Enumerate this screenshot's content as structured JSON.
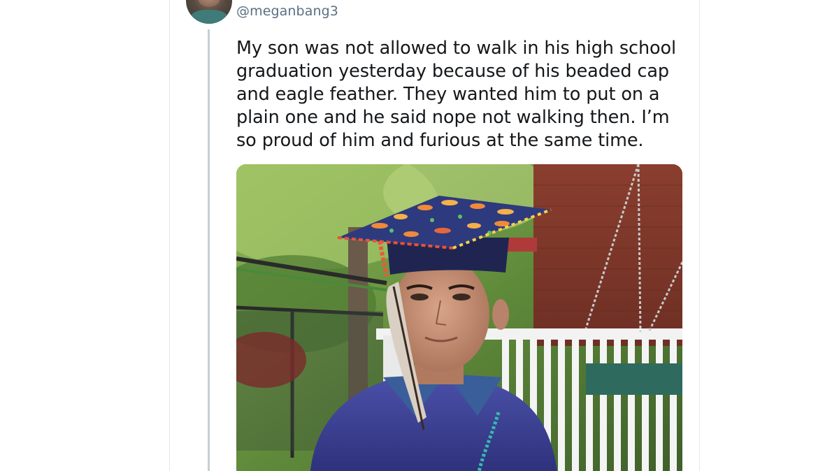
{
  "tweet": {
    "handle": "@meganbang3",
    "text": "My son was not allowed to walk in his high school graduation yesterday because of his beaded cap and eagle feather. They wanted him to put on a plain one and he said nope not walking then. I’m so proud of him and furious at the same time."
  },
  "icons": {
    "avatar": "user-avatar-photo",
    "thread": "thread-connector-line"
  },
  "colors": {
    "text": "#14171a",
    "handle": "#5b7083",
    "border": "#e1e8ed",
    "thread_line": "#c4cfd6"
  }
}
